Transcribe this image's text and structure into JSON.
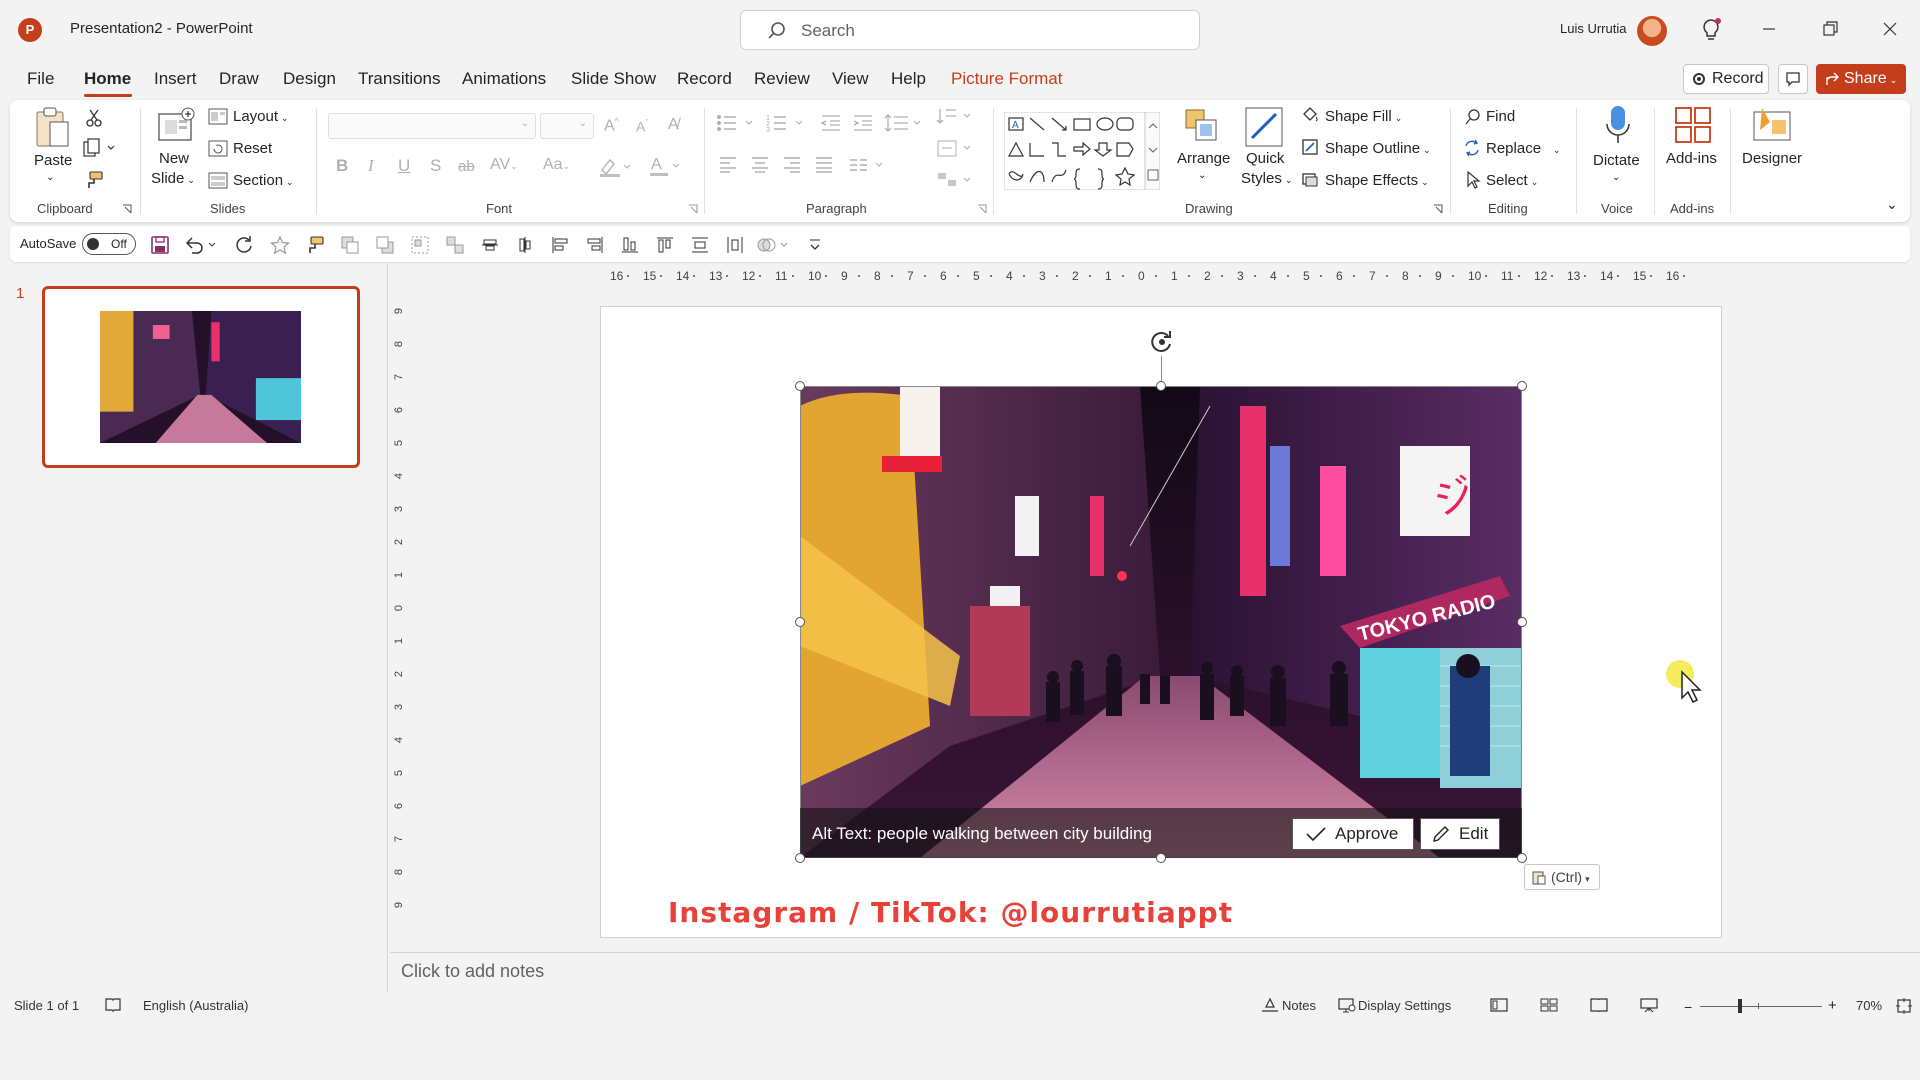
{
  "window": {
    "app_icon_letter": "P",
    "title": "Presentation2  -  PowerPoint",
    "search_placeholder": "Search",
    "user_name": "Luis Urrutia"
  },
  "menu": {
    "tabs": [
      "File",
      "Home",
      "Insert",
      "Draw",
      "Design",
      "Transitions",
      "Animations",
      "Slide Show",
      "Record",
      "Review",
      "View",
      "Help",
      "Picture Format"
    ],
    "active_tab": "Home",
    "record_label": "Record",
    "share_label": "Share"
  },
  "ribbon": {
    "clipboard": {
      "paste": "Paste",
      "group": "Clipboard"
    },
    "slides": {
      "new_slide_1": "New",
      "new_slide_2": "Slide",
      "layout": "Layout",
      "reset": "Reset",
      "section": "Section",
      "group": "Slides"
    },
    "font": {
      "group": "Font"
    },
    "paragraph": {
      "group": "Paragraph"
    },
    "drawing": {
      "arrange": "Arrange",
      "quick_styles_1": "Quick",
      "quick_styles_2": "Styles",
      "shape_fill": "Shape Fill",
      "shape_outline": "Shape Outline",
      "shape_effects": "Shape Effects",
      "group": "Drawing"
    },
    "editing": {
      "find": "Find",
      "replace": "Replace",
      "select": "Select",
      "group": "Editing"
    },
    "voice": {
      "dictate": "Dictate",
      "group": "Voice"
    },
    "addins": {
      "addins": "Add-ins",
      "group": "Add-ins"
    },
    "designer": {
      "designer": "Designer"
    }
  },
  "qat": {
    "autosave": "AutoSave",
    "toggle": "Off"
  },
  "slide_pane": {
    "slide_number": "1"
  },
  "rulers": {
    "horizontal": [
      "16",
      "15",
      "14",
      "13",
      "12",
      "11",
      "10",
      "9",
      "8",
      "7",
      "6",
      "5",
      "4",
      "3",
      "2",
      "1",
      "0",
      "1",
      "2",
      "3",
      "4",
      "5",
      "6",
      "7",
      "8",
      "9",
      "10",
      "11",
      "12",
      "13",
      "14",
      "15",
      "16"
    ],
    "vertical": [
      "9",
      "8",
      "7",
      "6",
      "5",
      "4",
      "3",
      "2",
      "1",
      "0",
      "1",
      "2",
      "3",
      "4",
      "5",
      "6",
      "7",
      "8",
      "9"
    ]
  },
  "slide": {
    "alt_text": "Alt Text: people walking between city building",
    "approve": "Approve",
    "edit": "Edit",
    "paste_ctrl": "(Ctrl)",
    "caption": "Instagram / TikTok: @lourrutiappt"
  },
  "notes": {
    "placeholder": "Click to add notes"
  },
  "status": {
    "slide_info": "Slide 1 of 1",
    "language": "English (Australia)",
    "notes": "Notes",
    "display_settings": "Display Settings",
    "zoom": "70%"
  },
  "colors": {
    "accent": "#c43e1c",
    "caption": "#e8413a"
  }
}
